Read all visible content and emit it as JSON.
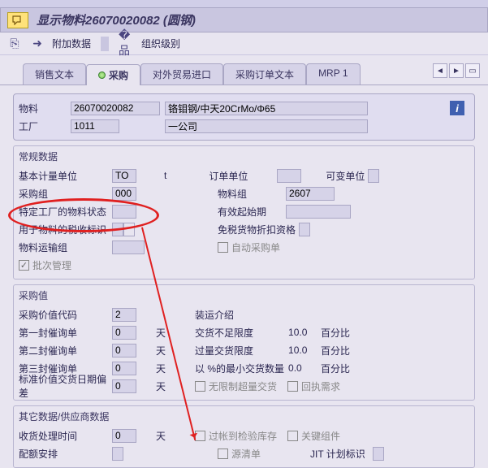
{
  "header": {
    "title": "显示物料26070020082 (圆钢)"
  },
  "toolbar": {
    "l1": "附加数据",
    "l2": "组织级别"
  },
  "tabs": {
    "t1": "销售文本",
    "t2": "采购",
    "t3": "对外贸易进口",
    "t4": "采购订单文本",
    "t5": "MRP 1"
  },
  "basic": {
    "mat": "物料",
    "matv": "26070020082",
    "matd": "铬钼钢/中天20CrMo/Φ65",
    "plant": "工厂",
    "plantv": "1011",
    "plantd": "一公司"
  },
  "g1": {
    "title": "常规数据",
    "r": [
      {
        "l1": "基本计量单位",
        "v1": "TO",
        "u1": "t",
        "l2": "订单单位",
        "v2": "",
        "l3": "可变单位",
        "v3": ""
      },
      {
        "l1": "采购组",
        "v1": "000",
        "l2": "物料组",
        "v2": "2607"
      },
      {
        "l1": "特定工厂的物料状态",
        "v1": "",
        "l2": "有效起始期",
        "v2": ""
      },
      {
        "l1": "用于物料的税收标识",
        "v1": "",
        "l2": "免税货物折扣资格",
        "v2": ""
      },
      {
        "l1": "物料运输组",
        "v1": "",
        "c2": "自动采购单"
      },
      {
        "c1": "批次管理",
        "c1v": true
      }
    ]
  },
  "g2": {
    "title": "采购值",
    "r": [
      {
        "l1": "采购价值代码",
        "v1": "2",
        "l2": "装运介绍"
      },
      {
        "l1": "第一封催询单",
        "v1": "0",
        "u1": "天",
        "l2": "交货不足限度",
        "v2": "10.0",
        "u2": "百分比"
      },
      {
        "l1": "第二封催询单",
        "v1": "0",
        "u1": "天",
        "l2": "过量交货限度",
        "v2": "10.0",
        "u2": "百分比"
      },
      {
        "l1": "第三封催询单",
        "v1": "0",
        "u1": "天",
        "l2": "以 %的最小交货数量",
        "v2": "0.0",
        "u2": "百分比"
      },
      {
        "l1": "标准价值交货日期偏差",
        "v1": "0",
        "u1": "天",
        "c2": "无限制超量交货",
        "c3": "回执需求"
      }
    ]
  },
  "g3": {
    "title": "其它数据/供应商数据",
    "r": [
      {
        "l1": "收货处理时间",
        "v1": "0",
        "u1": "天",
        "c2": "过帐到检验库存",
        "c3": "关键组件"
      },
      {
        "l1": "配额安排",
        "v1": "",
        "c2": "源清单",
        "l3": "JIT 计划标识",
        "v3": ""
      }
    ]
  }
}
